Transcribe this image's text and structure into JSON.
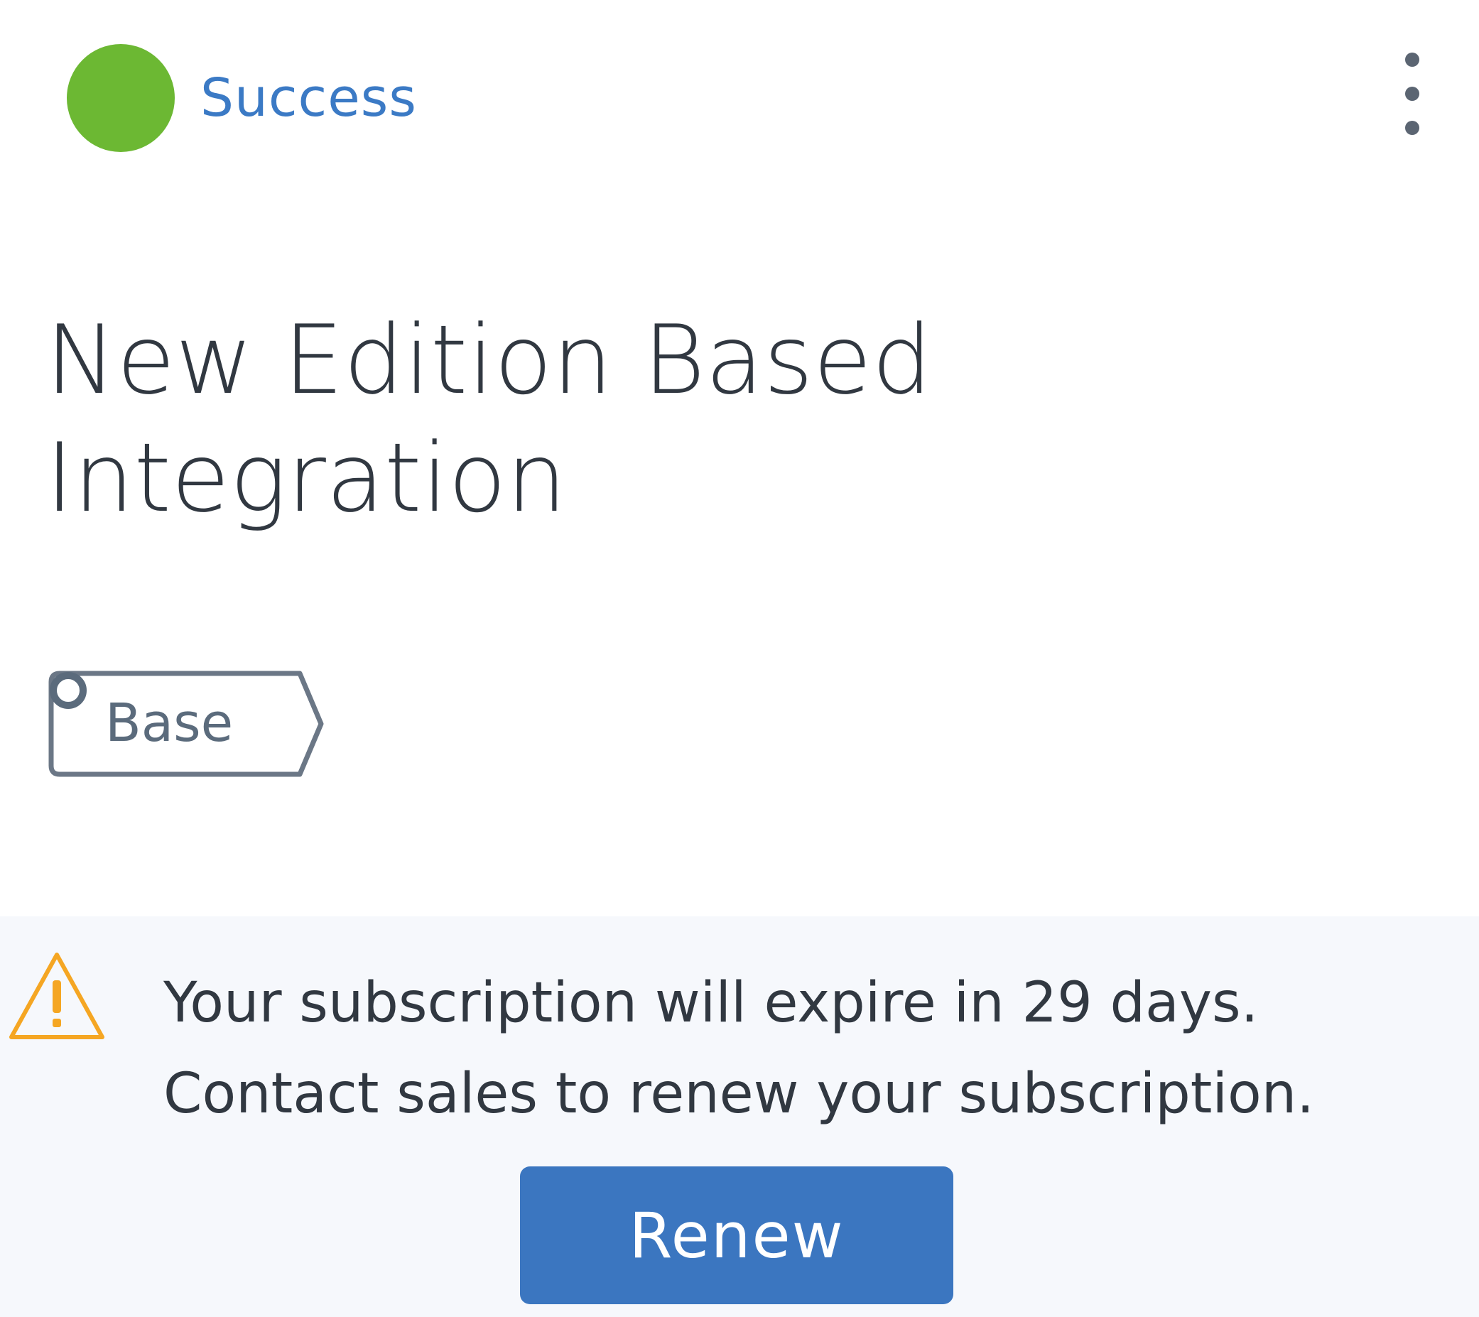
{
  "status": {
    "label": "Success",
    "color": "#6cb833",
    "icon": "status-dot"
  },
  "card": {
    "title": "New Edition Based Integration",
    "menu_icon": "more-vertical-icon"
  },
  "tag": {
    "label": "Base",
    "icon": "ring-icon"
  },
  "alert": {
    "icon": "warning-icon",
    "line1": "Your subscription will expire in 29 days.",
    "line2": "Contact sales to renew your subscription.",
    "button_label": "Renew",
    "warning_color": "#f5a623",
    "button_color": "#3b76c0"
  }
}
